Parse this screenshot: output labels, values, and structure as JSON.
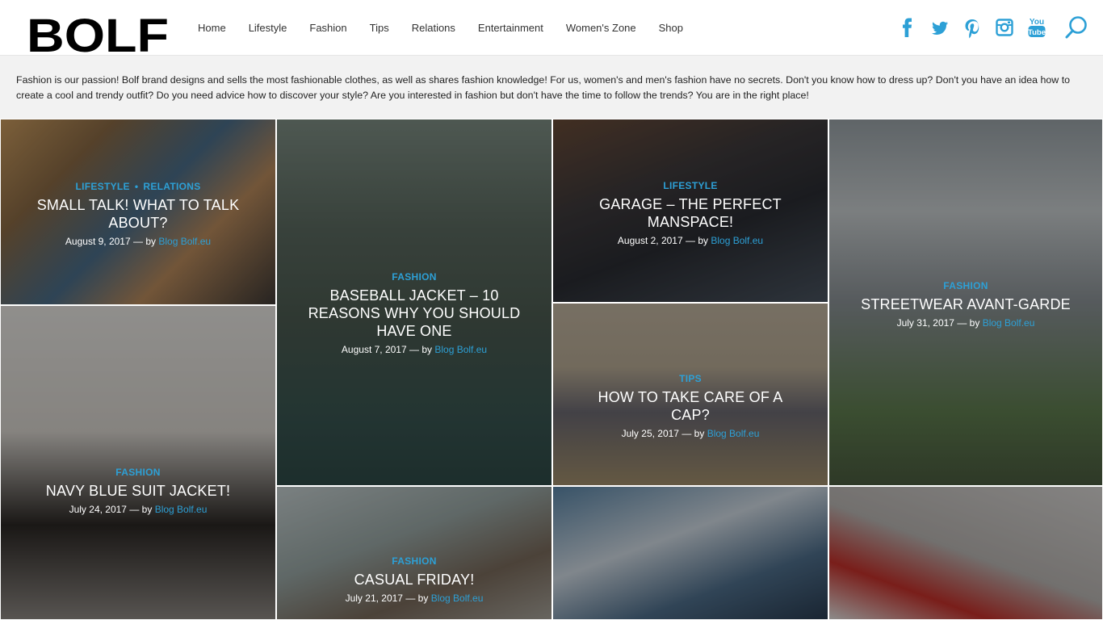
{
  "brand": {
    "logo_text": "BOLF"
  },
  "nav": {
    "items": [
      "Home",
      "Lifestyle",
      "Fashion",
      "Tips",
      "Relations",
      "Entertainment",
      "Women's Zone",
      "Shop"
    ]
  },
  "social": {
    "icons": [
      "facebook-icon",
      "twitter-icon",
      "pinterest-icon",
      "instagram-icon",
      "youtube-icon"
    ],
    "youtube_text_1": "You",
    "youtube_text_2": "Tube"
  },
  "search": {
    "icon": "search-icon"
  },
  "intro": {
    "text": "Fashion is our passion! Bolf brand designs and sells the most fashionable clothes, as well as shares fashion knowledge! For us, women's and men's fashion have no secrets. Don't you know how to dress up? Don't you have an idea how to create a cool and trendy outfit? Do you need advice how to discover your style? Are you interested in fashion but don't have the time to follow the trends? You are in the right place!"
  },
  "colors": {
    "accent": "#2da0d6",
    "intro_bg": "#f2f2f2"
  },
  "posts": [
    {
      "cat1": "LIFESTYLE",
      "cat2": "RELATIONS",
      "title": "SMALL TALK! WHAT TO TALK ABOUT?",
      "date": "August 9, 2017",
      "by": "— by",
      "author": "Blog Bolf.eu"
    },
    {
      "cat1": "FASHION",
      "title": "BASEBALL JACKET – 10 REASONS WHY YOU SHOULD HAVE ONE",
      "date": "August 7, 2017",
      "by": "— by",
      "author": "Blog Bolf.eu"
    },
    {
      "cat1": "LIFESTYLE",
      "title": "GARAGE – THE PERFECT MANSPACE!",
      "date": "August 2, 2017",
      "by": "— by",
      "author": "Blog Bolf.eu"
    },
    {
      "cat1": "FASHION",
      "title": "STREETWEAR AVANT-GARDE",
      "date": "July 31, 2017",
      "by": "— by",
      "author": "Blog Bolf.eu"
    },
    {
      "cat1": "TIPS",
      "title": "HOW TO TAKE CARE OF A CAP?",
      "date": "July 25, 2017",
      "by": "— by",
      "author": "Blog Bolf.eu"
    },
    {
      "cat1": "FASHION",
      "title": "NAVY BLUE SUIT JACKET!",
      "date": "July 24, 2017",
      "by": "— by",
      "author": "Blog Bolf.eu"
    },
    {
      "cat1": "FASHION",
      "title": "CASUAL FRIDAY!",
      "date": "July 21, 2017",
      "by": "— by",
      "author": "Blog Bolf.eu"
    }
  ]
}
